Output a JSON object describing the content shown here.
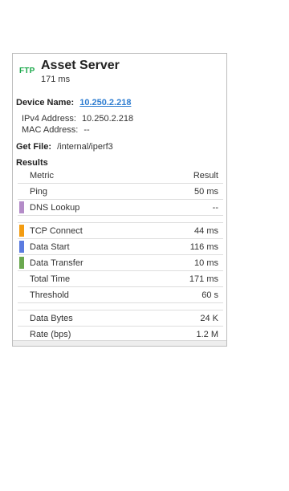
{
  "header": {
    "badge": "FTP",
    "title": "Asset Server",
    "subtitle": "171 ms"
  },
  "device": {
    "label": "Device Name:",
    "name": "10.250.2.218",
    "ipv4_label": "IPv4 Address:",
    "ipv4": "10.250.2.218",
    "mac_label": "MAC Address:",
    "mac": "--"
  },
  "getfile": {
    "label": "Get File:",
    "path": "/internal/iperf3"
  },
  "results": {
    "label": "Results",
    "header": {
      "metric": "Metric",
      "result": "Result"
    },
    "rows1": [
      {
        "metric": "Ping",
        "value": "50 ms",
        "color": ""
      },
      {
        "metric": "DNS Lookup",
        "value": "--",
        "color": "#b48cc8"
      }
    ],
    "rows2": [
      {
        "metric": "TCP Connect",
        "value": "44 ms",
        "color": "#f39c12"
      },
      {
        "metric": "Data Start",
        "value": "116 ms",
        "color": "#5b7be0"
      },
      {
        "metric": "Data Transfer",
        "value": "10 ms",
        "color": "#6aa84f"
      },
      {
        "metric": "Total Time",
        "value": "171 ms",
        "color": ""
      },
      {
        "metric": "Threshold",
        "value": "60 s",
        "color": ""
      }
    ],
    "rows3": [
      {
        "metric": "Data Bytes",
        "value": "24 K",
        "color": ""
      },
      {
        "metric": "Rate (bps)",
        "value": "1.2 M",
        "color": ""
      }
    ]
  }
}
